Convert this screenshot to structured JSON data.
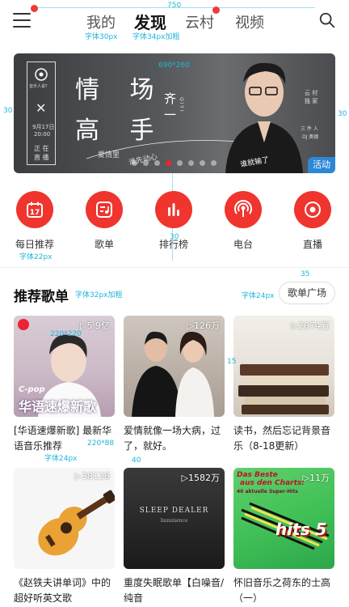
{
  "header": {
    "tabs": [
      {
        "label": "我的"
      },
      {
        "label": "发现"
      },
      {
        "label": "云村"
      },
      {
        "label": "视频"
      }
    ]
  },
  "annotations": {
    "top_width": "750",
    "font30": "字体30px",
    "font34": "字体34px加粗",
    "banner_size": "690*260",
    "side_left": "30",
    "side_right": "30",
    "icon_font": "字体22px",
    "gap30": "30",
    "gap35": "35",
    "section_font": "字体32px加粗",
    "plaza_font": "字体24px",
    "cover_size_1": "220*220",
    "cover_size_2": "220*88",
    "gap15": "15",
    "title_font": "字体24px",
    "gap40": "40"
  },
  "banner": {
    "line1": "情 场",
    "line2": "高 手",
    "artist": "齐 一",
    "artist_en": "Q I Y I",
    "caption1": "爱情里",
    "caption2": "谁先动心",
    "caption3": "谁就输了",
    "date": "9月17日",
    "time": "20:00",
    "live1": "正 在",
    "live2": "直 播",
    "right1": "云 村",
    "right2": "独 家",
    "right3": "三 件 人",
    "right4": "DJ 奥德",
    "logo_text": "音乐人说？",
    "tag": "活动"
  },
  "icons": [
    {
      "label": "每日推荐",
      "name": "daily-recommend",
      "glyph": "17"
    },
    {
      "label": "歌单",
      "name": "playlist",
      "glyph": ""
    },
    {
      "label": "排行榜",
      "name": "charts",
      "glyph": ""
    },
    {
      "label": "电台",
      "name": "radio",
      "glyph": ""
    },
    {
      "label": "直播",
      "name": "live",
      "glyph": ""
    }
  ],
  "section": {
    "title": "推荐歌单",
    "plaza_label": "歌单广场"
  },
  "playlists": [
    {
      "title": "[华语速爆新歌] 最新华语音乐推荐",
      "plays": "▷5.9亿",
      "cover_text1": "C-pop",
      "cover_text2": "华语速爆新歌"
    },
    {
      "title": "爱情就像一场大病，过了，就好。",
      "plays": "▷126万"
    },
    {
      "title": "读书，然后忘记背景音乐（8-18更新）",
      "plays": "▷2074万"
    },
    {
      "title": "《赵铁夫讲单词》中的超好听英文歌",
      "plays": "▷38128"
    },
    {
      "title": "重度失眠歌单【白噪音/纯音",
      "plays": "▷1582万",
      "cover_text1": "SLEEP DEALER",
      "cover_text2": "Imminence"
    },
    {
      "title": "怀旧音乐之荷东的士高（一）",
      "plays": "▷11万",
      "cover_text1": "Das Beste",
      "cover_text2": "aus den Charts:",
      "cover_text3": "40 aktuelle Super-Hits",
      "cover_text4": "hits 5"
    }
  ],
  "colors": {
    "accent": "#f0342e",
    "annotation": "#20b5d8",
    "banner_tag": "#2d87d6"
  }
}
